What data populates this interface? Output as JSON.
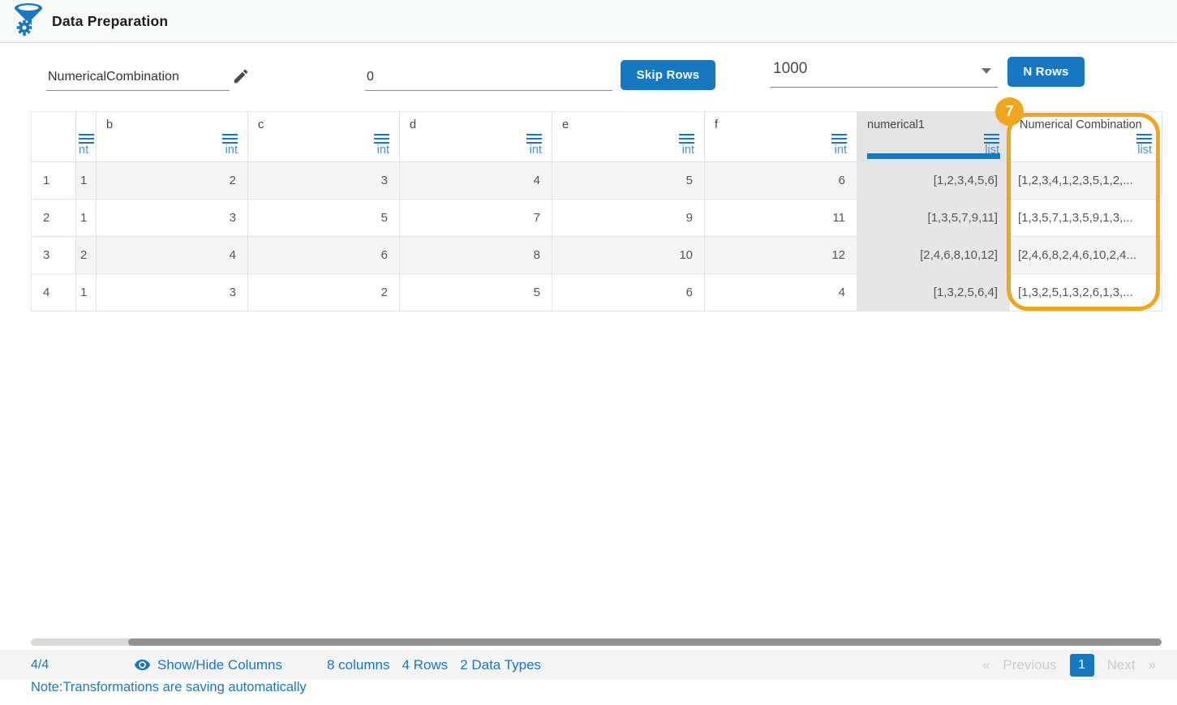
{
  "topbar": {
    "title": "Data Preparation"
  },
  "toolbar": {
    "column_name_input": "NumericalCombination",
    "skip_rows_value": "0",
    "skip_rows_button": "Skip Rows",
    "n_rows_value": "1000",
    "n_rows_button": "N Rows"
  },
  "table": {
    "badge": "7",
    "columns": [
      {
        "name": "",
        "type": "nt"
      },
      {
        "name": "b",
        "type": "int"
      },
      {
        "name": "c",
        "type": "int"
      },
      {
        "name": "d",
        "type": "int"
      },
      {
        "name": "e",
        "type": "int"
      },
      {
        "name": "f",
        "type": "int"
      },
      {
        "name": "numerical1",
        "type": "list"
      },
      {
        "name": "Numerical Combination",
        "type": "list"
      }
    ],
    "rows": [
      {
        "index": "1",
        "cells": [
          "1",
          "2",
          "3",
          "4",
          "5",
          "6",
          "[1,2,3,4,5,6]",
          "[1,2,3,4,1,2,3,5,1,2,..."
        ]
      },
      {
        "index": "2",
        "cells": [
          "1",
          "3",
          "5",
          "7",
          "9",
          "11",
          "[1,3,5,7,9,11]",
          "[1,3,5,7,1,3,5,9,1,3,..."
        ]
      },
      {
        "index": "3",
        "cells": [
          "2",
          "4",
          "6",
          "8",
          "10",
          "12",
          "[2,4,6,8,10,12]",
          "[2,4,6,8,2,4,6,10,2,4..."
        ]
      },
      {
        "index": "4",
        "cells": [
          "1",
          "3",
          "2",
          "5",
          "6",
          "4",
          "[1,3,2,5,6,4]",
          "[1,3,2,5,1,3,2,6,1,3,..."
        ]
      }
    ]
  },
  "footer": {
    "page_fraction": "4/4",
    "show_hide_label": "Show/Hide Columns",
    "columns_count": "8 columns",
    "rows_count": "4 Rows",
    "data_types_count": "2 Data Types",
    "pagination": {
      "first_symbol": "«",
      "previous_label": "Previous",
      "current_page": "1",
      "next_label": "Next",
      "last_symbol": "»"
    },
    "note": "Note:Transformations are saving automatically"
  },
  "colors": {
    "accent": "#1778c2",
    "highlight": "#f2a41d"
  }
}
